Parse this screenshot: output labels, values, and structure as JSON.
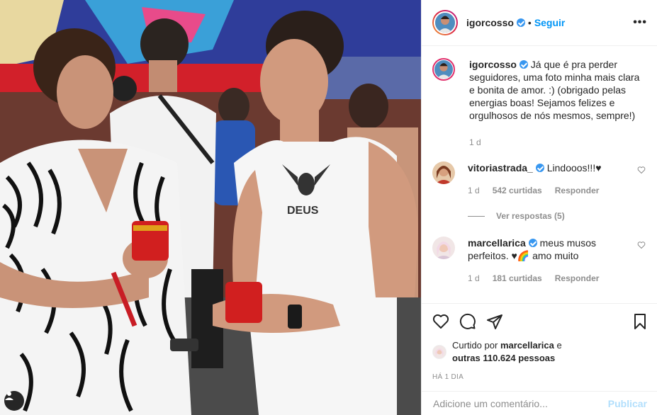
{
  "post": {
    "username": "igorcosso",
    "follow_label": "Seguir",
    "more_label": "•••",
    "separator": "•"
  },
  "caption": {
    "username": "igorcosso",
    "text": "Já que é pra perder seguidores, uma foto minha mais clara e bonita de amor. :) (obrigado pelas energias boas! Sejamos felizes e orgulhosos de nós mesmos, sempre!)",
    "age": "1 d"
  },
  "comments": [
    {
      "username": "vitoriastrada_",
      "text": "Lindooos!!!♥",
      "age": "1 d",
      "likes": "542 curtidas",
      "reply_label": "Responder",
      "view_replies": "Ver respostas (5)"
    },
    {
      "username": "marcellarica",
      "text": "meus musos perfeitos. ♥🌈 amo muito",
      "age": "1 d",
      "likes": "181 curtidas",
      "reply_label": "Responder"
    }
  ],
  "likes": {
    "prefix": "Curtido por",
    "user": "marcellarica",
    "connector": "e",
    "others": "outras 110.624 pessoas"
  },
  "date": "HÁ 1 DIA",
  "add_comment": {
    "placeholder": "Adicione um comentário...",
    "publish_label": "Publicar"
  },
  "icons": {
    "like": "heart-icon",
    "comment": "comment-icon",
    "share": "paper-plane-icon",
    "save": "bookmark-icon",
    "user_tags": "user-icon",
    "verified": "verified-badge-icon"
  },
  "colors": {
    "link": "#0095f6",
    "verified": "#3897f0",
    "publish_disabled": "#b2dffc",
    "muted": "#8e8e8e",
    "text": "#262626"
  }
}
